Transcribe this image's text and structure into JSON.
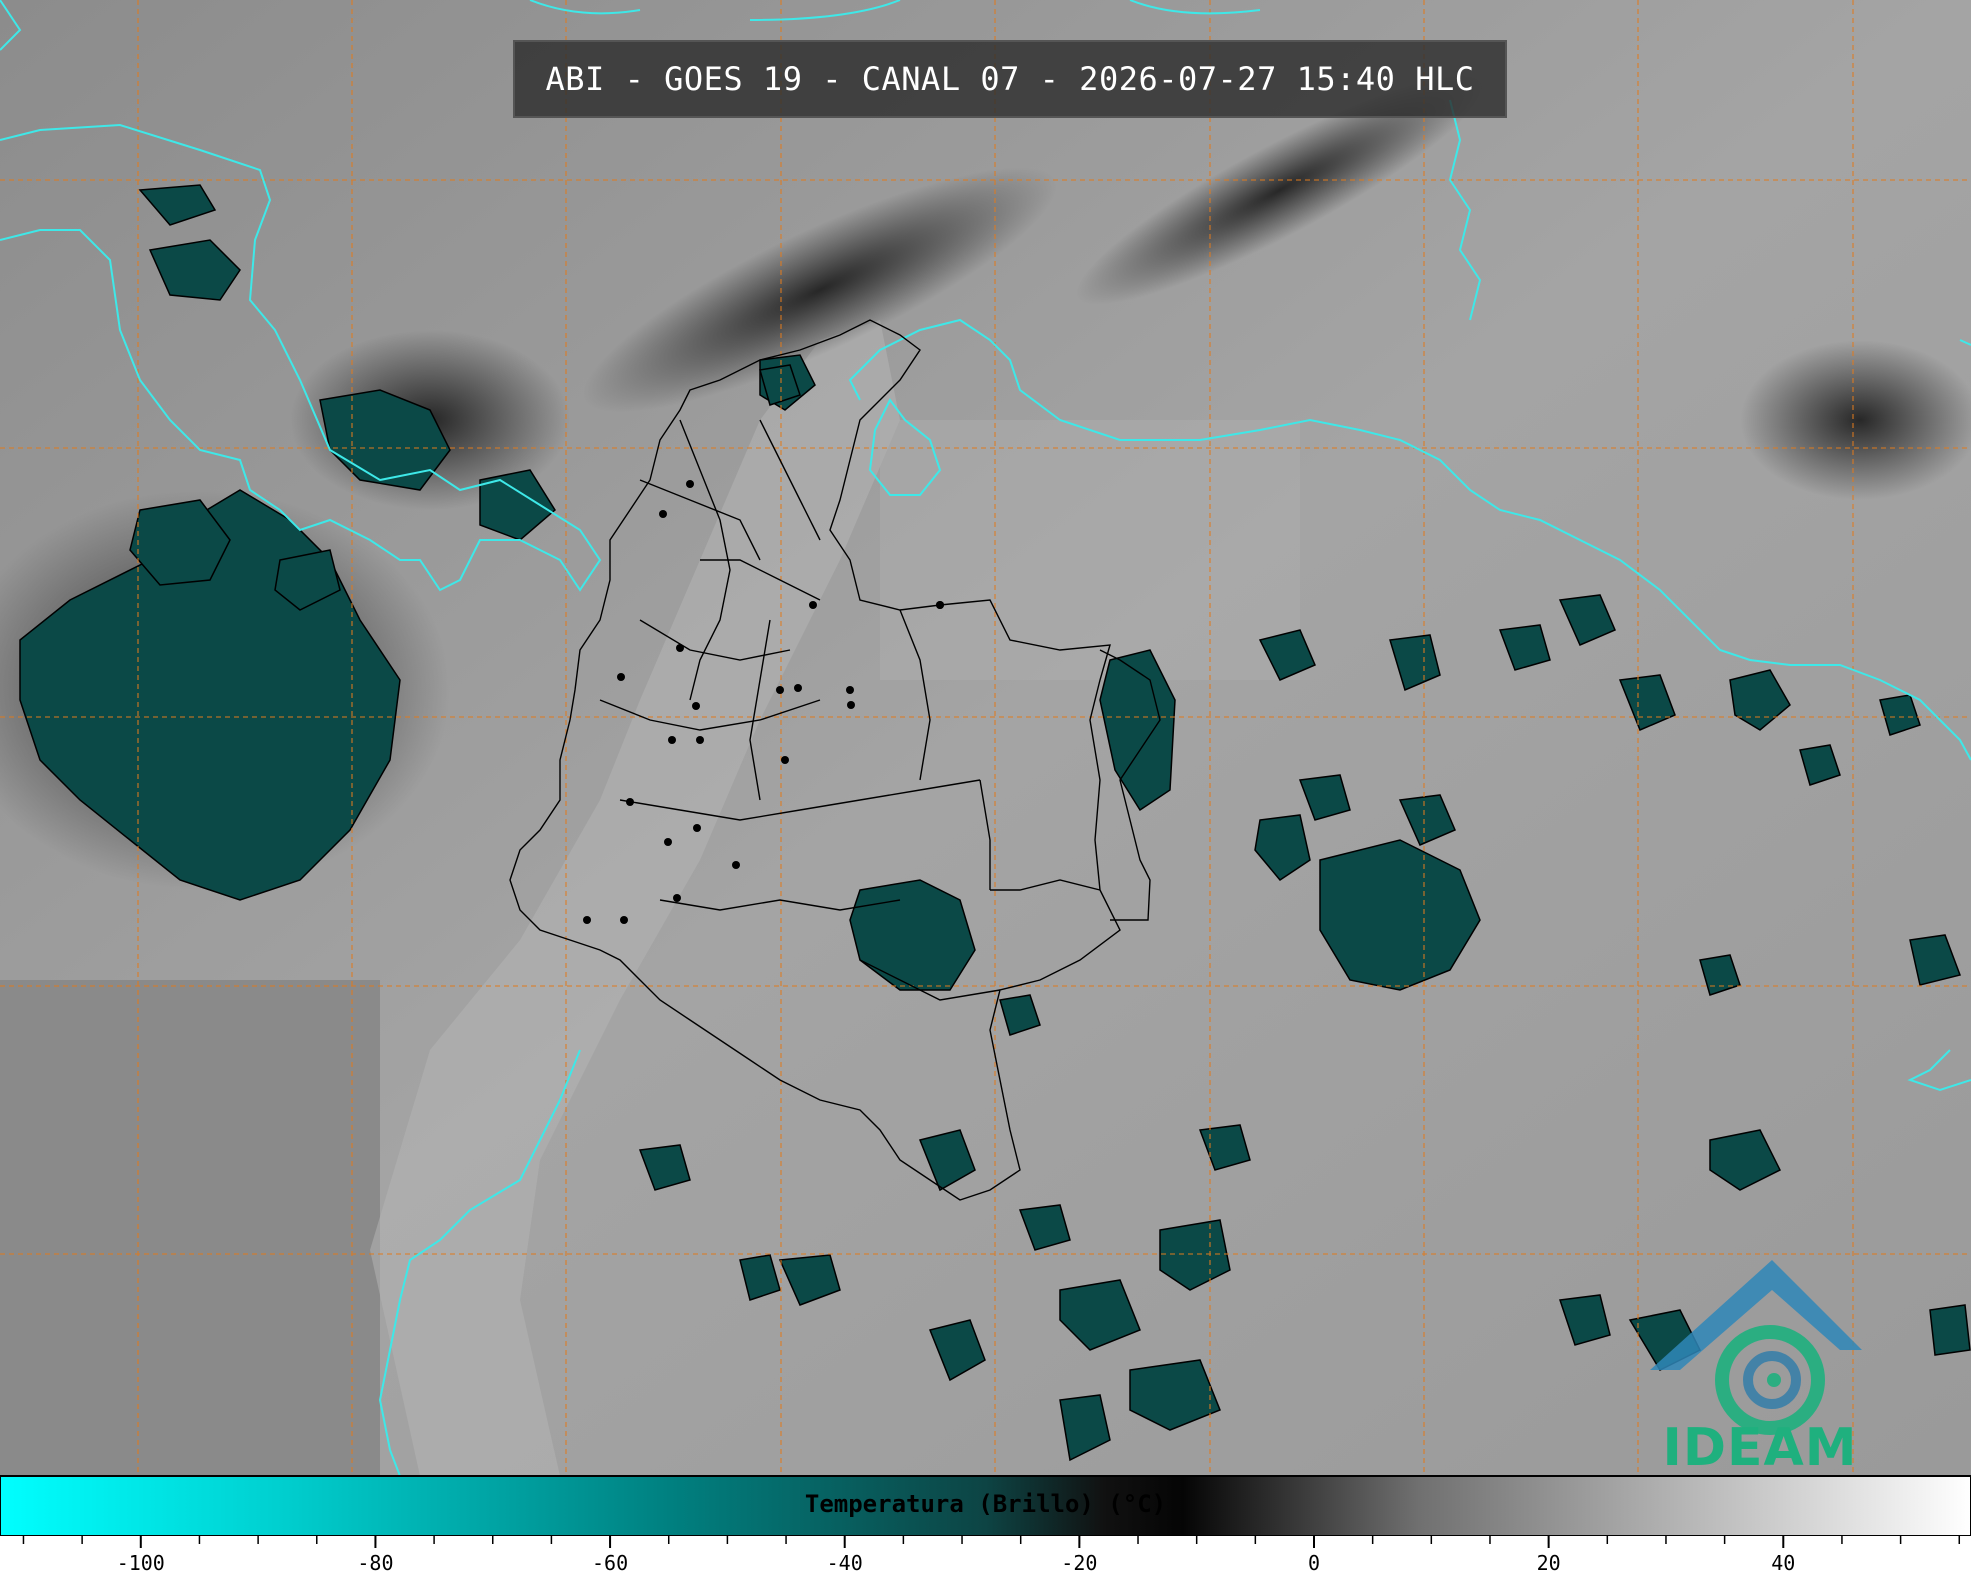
{
  "title": "ABI - GOES 19 - CANAL 07 - 2026-07-27 15:40 HLC",
  "colorbar": {
    "label": "Temperatura (Brillo) (°C)",
    "ticks": [
      "-100",
      "-80",
      "-60",
      "-40",
      "-20",
      "0",
      "20",
      "40"
    ],
    "tick_values": [
      -100,
      -80,
      -60,
      -40,
      -20,
      0,
      20,
      40
    ],
    "range": [
      -112,
      56
    ],
    "colors": [
      "#00ffff",
      "#00c8c8",
      "#008c8c",
      "#0f4f4f",
      "#000000",
      "#808080",
      "#ffffff"
    ]
  },
  "logo": {
    "text": "IDEAM",
    "color": "#1fb07e"
  },
  "map": {
    "coast_color": "#3ee8e8",
    "border_color": "#000000",
    "graticule_color": "#e07b1e",
    "cold_cloud_color": "#0a4a48",
    "background_gray": "#9c9c9c"
  }
}
